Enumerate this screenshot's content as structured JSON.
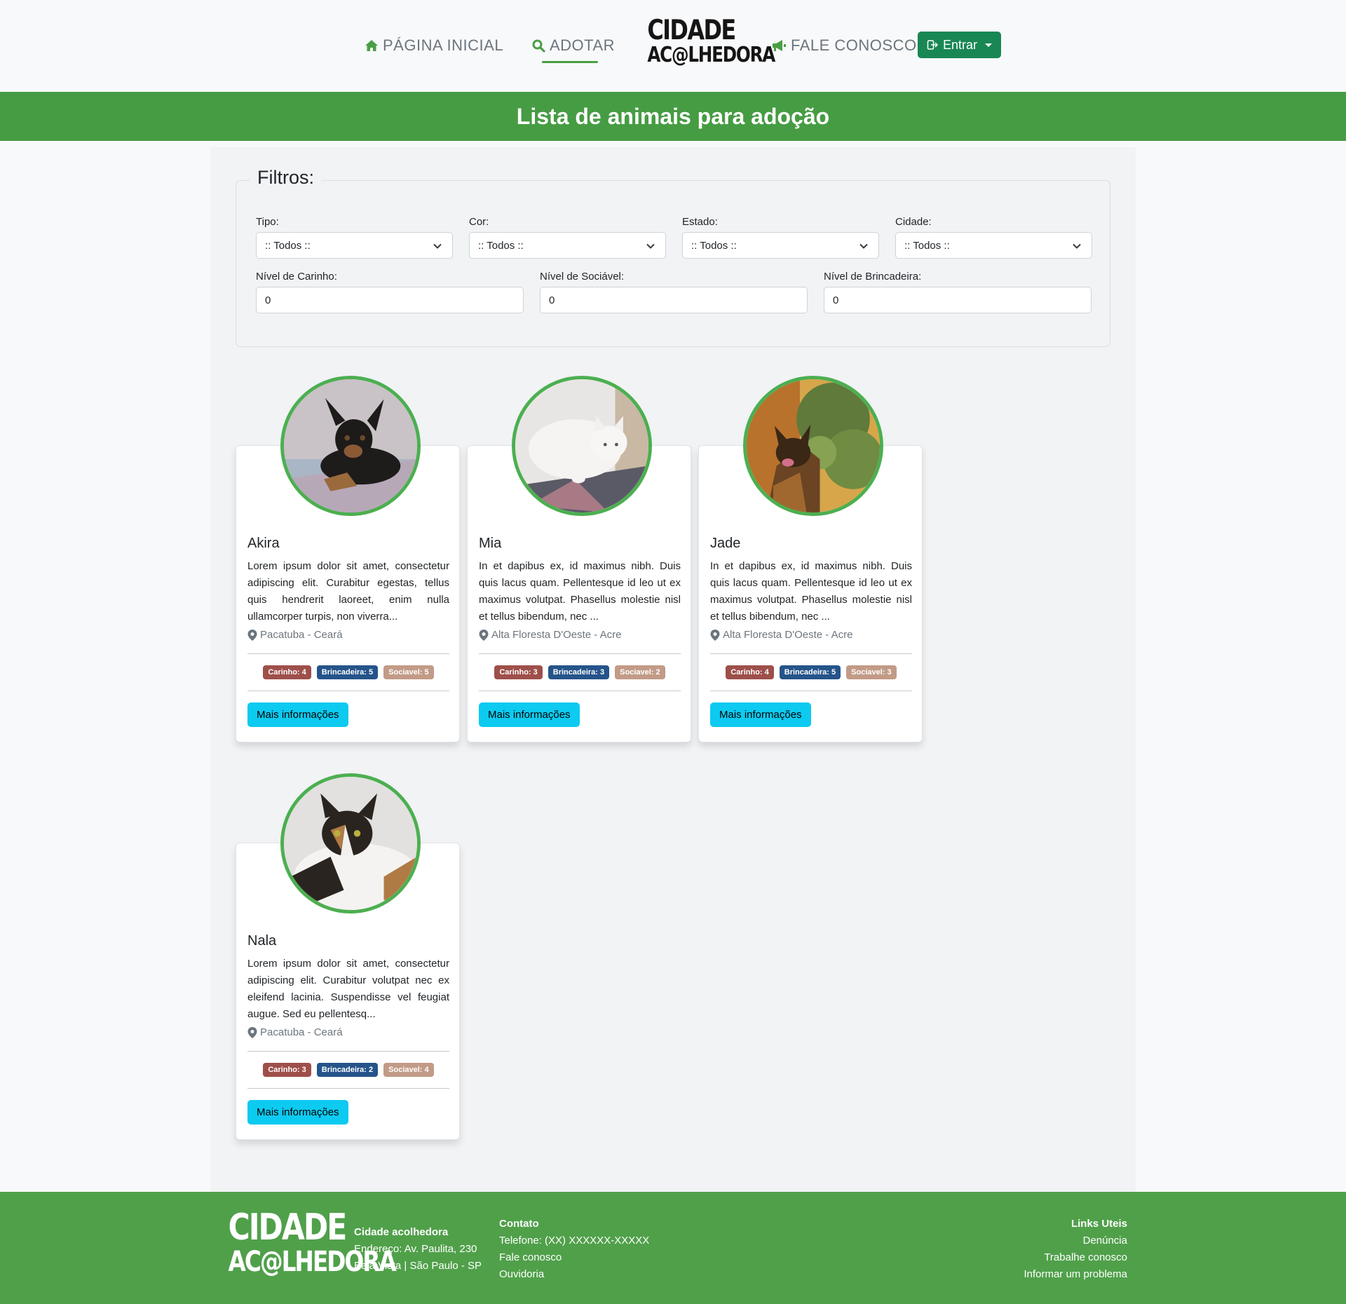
{
  "nav": {
    "home": "PÁGINA INICIAL",
    "adopt": "ADOTAR",
    "contact": "FALE CONOSCO",
    "login": "Entrar",
    "logo_line1": "CIDADE",
    "logo_line2": "AC@LHEDORA"
  },
  "hero": {
    "title": "Lista de animais para adoção"
  },
  "filters": {
    "legend": "Filtros:",
    "tipo": {
      "label": "Tipo:",
      "value": ":: Todos ::"
    },
    "cor": {
      "label": "Cor:",
      "value": ":: Todos ::"
    },
    "estado": {
      "label": "Estado:",
      "value": ":: Todos ::"
    },
    "cidade": {
      "label": "Cidade:",
      "value": ":: Todos ::"
    },
    "carinho": {
      "label": "Nível de Carinho:",
      "value": "0"
    },
    "sociavel": {
      "label": "Nível de Sociável:",
      "value": "0"
    },
    "brincadeira": {
      "label": "Nível de Brincadeira:",
      "value": "0"
    }
  },
  "animals": [
    {
      "name": "Akira",
      "description": "Lorem ipsum dolor sit amet, consectetur adipiscing elit. Curabitur egestas, tellus quis hendrerit laoreet, enim nulla ullamcorper turpis, non viverra...",
      "location": "Pacatuba - Ceará",
      "carinho": "Carinho: 4",
      "brincadeira": "Brincadeira: 5",
      "sociavel": "Sociavel: 5",
      "button": "Mais informações"
    },
    {
      "name": "Mia",
      "description": "In et dapibus ex, id maximus nibh. Duis quis lacus quam. Pellentesque id leo ut ex maximus volutpat. Phasellus molestie nisl et tellus bibendum, nec ...",
      "location": "Alta Floresta D'Oeste - Acre",
      "carinho": "Carinho: 3",
      "brincadeira": "Brincadeira: 3",
      "sociavel": "Sociavel: 2",
      "button": "Mais informações"
    },
    {
      "name": "Jade",
      "description": "In et dapibus ex, id maximus nibh. Duis quis lacus quam. Pellentesque id leo ut ex maximus volutpat. Phasellus molestie nisl et tellus bibendum, nec ...",
      "location": "Alta Floresta D'Oeste - Acre",
      "carinho": "Carinho: 4",
      "brincadeira": "Brincadeira: 5",
      "sociavel": "Sociavel: 3",
      "button": "Mais informações"
    },
    {
      "name": "Nala",
      "description": "Lorem ipsum dolor sit amet, consectetur adipiscing elit. Curabitur volutpat nec ex eleifend lacinia. Suspendisse vel feugiat augue. Sed eu pellentesq...",
      "location": "Pacatuba - Ceará",
      "carinho": "Carinho: 3",
      "brincadeira": "Brincadeira: 2",
      "sociavel": "Sociavel: 4",
      "button": "Mais informações"
    }
  ],
  "footer": {
    "org_title": "Cidade acolhedora",
    "address1": "Endereço: Av. Paulita, 230",
    "address2": "Bela Vista | São Paulo - SP",
    "contact_title": "Contato",
    "phone": "Telefone: (XX) XXXXXX-XXXXX",
    "fale": "Fale conosco",
    "ouvidoria": "Ouvidoria",
    "links_title": "Links Uteis",
    "denuncia": "Denúncia",
    "trabalhe": "Trabalhe conosco",
    "problema": "Informar um problema"
  },
  "colors": {
    "primary_green": "#469c43",
    "footer_green": "#50a04a",
    "button_green": "#198754",
    "info_button": "#0dcaf0",
    "badge_carinho": "#9e4f4a",
    "badge_brincadeira": "#25548a",
    "badge_sociavel": "#c29b87"
  }
}
